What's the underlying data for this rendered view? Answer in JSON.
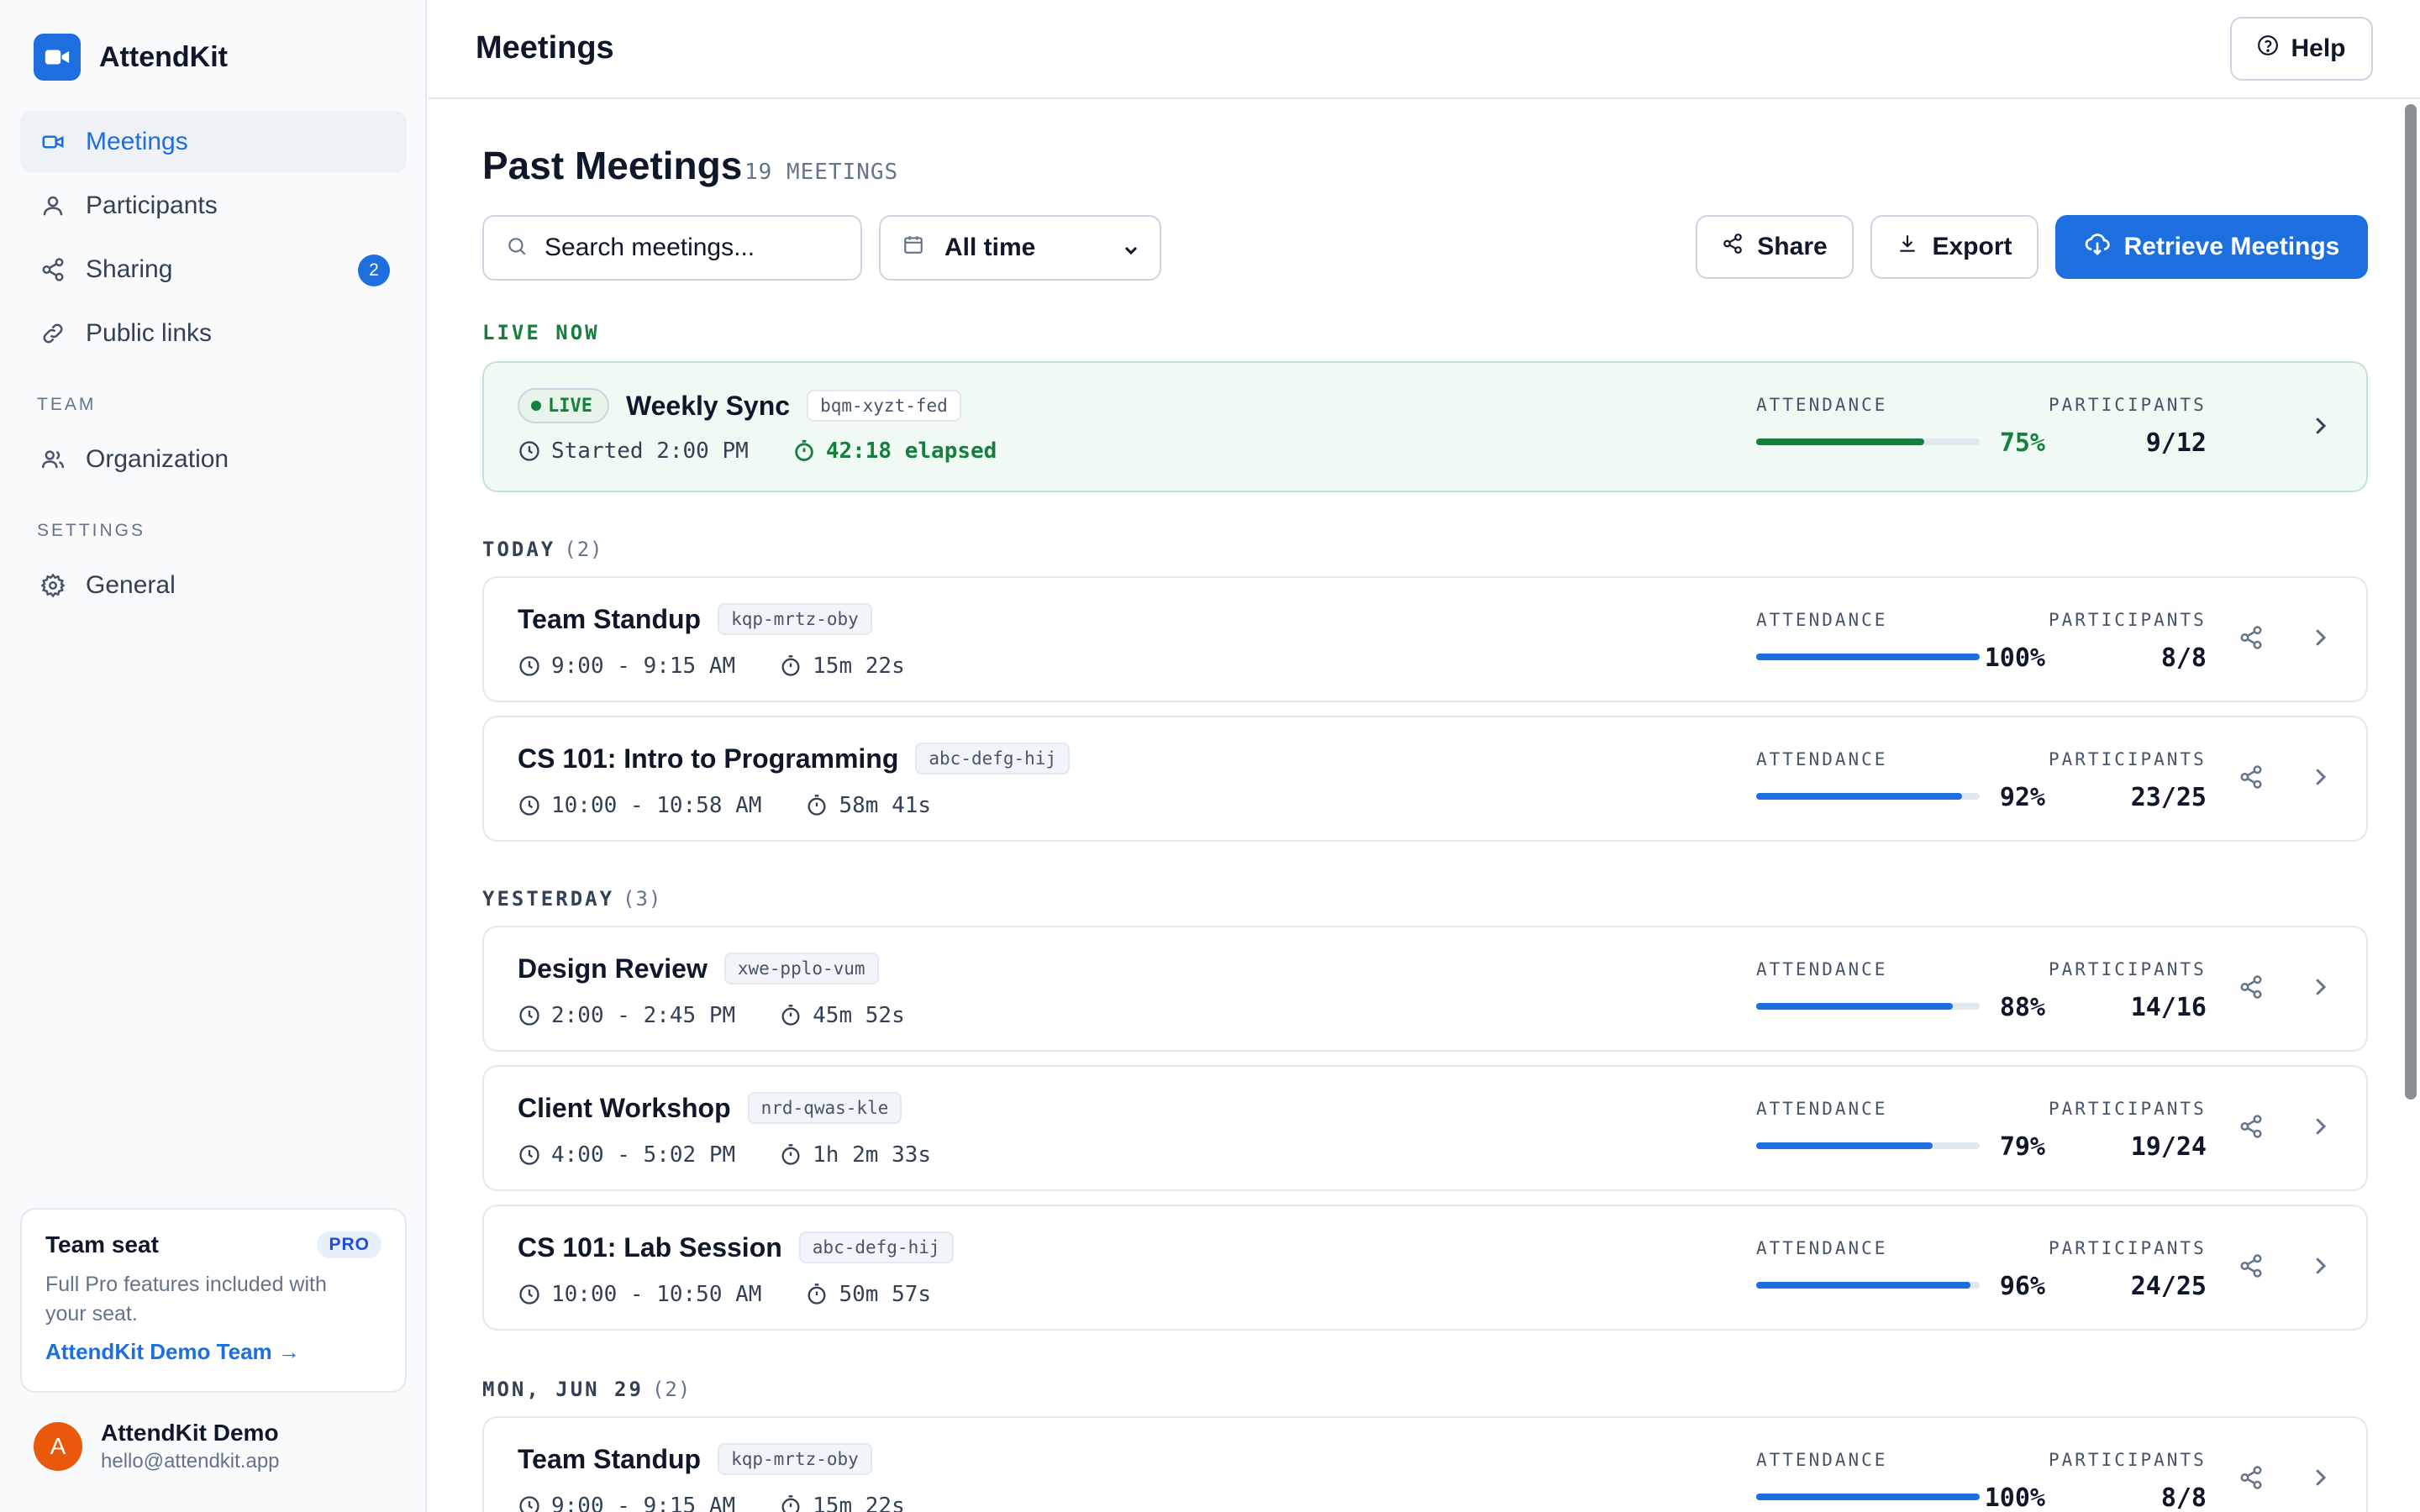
{
  "brand": {
    "name": "AttendKit"
  },
  "sidebar": {
    "items": [
      {
        "label": "Meetings",
        "icon": "video-icon",
        "active": true
      },
      {
        "label": "Participants",
        "icon": "user-icon"
      },
      {
        "label": "Sharing",
        "icon": "share-icon",
        "badge": "2"
      },
      {
        "label": "Public links",
        "icon": "link-icon"
      }
    ],
    "team_section": "TEAM",
    "team_items": [
      {
        "label": "Organization",
        "icon": "users-icon"
      }
    ],
    "settings_section": "SETTINGS",
    "settings_items": [
      {
        "label": "General",
        "icon": "gear-icon"
      }
    ],
    "seat": {
      "title": "Team seat",
      "badge": "PRO",
      "description": "Full Pro features included with your seat.",
      "link": "AttendKit Demo Team →"
    },
    "user": {
      "initial": "A",
      "name": "AttendKit Demo",
      "email": "hello@attendkit.app"
    }
  },
  "topbar": {
    "title": "Meetings",
    "help_label": "Help"
  },
  "main": {
    "title": "Past Meetings",
    "count": "19 MEETINGS",
    "search_placeholder": "Search meetings...",
    "date_filter": "All time",
    "share_label": "Share",
    "export_label": "Export",
    "retrieve_label": "Retrieve Meetings",
    "attendance_label": "ATTENDANCE",
    "participants_label": "PARTICIPANTS"
  },
  "live": {
    "section": "LIVE NOW",
    "badge": "LIVE",
    "title": "Weekly Sync",
    "code": "bqm-xyzt-fed",
    "started": "Started 2:00 PM",
    "elapsed": "42:18 elapsed",
    "attendance_pct": "75%",
    "attendance_value": 0.75,
    "participants": "9/12"
  },
  "sections": [
    {
      "label": "TODAY",
      "count": "(2)",
      "meetings": [
        {
          "title": "Team Standup",
          "code": "kqp-mrtz-oby",
          "time": "9:00 - 9:15 AM",
          "duration": "15m 22s",
          "attendance_pct": "100%",
          "attendance_value": 1.0,
          "participants": "8/8"
        },
        {
          "title": "CS 101: Intro to Programming",
          "code": "abc-defg-hij",
          "time": "10:00 - 10:58 AM",
          "duration": "58m 41s",
          "attendance_pct": "92%",
          "attendance_value": 0.92,
          "participants": "23/25"
        }
      ]
    },
    {
      "label": "YESTERDAY",
      "count": "(3)",
      "meetings": [
        {
          "title": "Design Review",
          "code": "xwe-pplo-vum",
          "time": "2:00 - 2:45 PM",
          "duration": "45m 52s",
          "attendance_pct": "88%",
          "attendance_value": 0.88,
          "participants": "14/16"
        },
        {
          "title": "Client Workshop",
          "code": "nrd-qwas-kle",
          "time": "4:00 - 5:02 PM",
          "duration": "1h 2m 33s",
          "attendance_pct": "79%",
          "attendance_value": 0.79,
          "participants": "19/24"
        },
        {
          "title": "CS 101: Lab Session",
          "code": "abc-defg-hij",
          "time": "10:00 - 10:50 AM",
          "duration": "50m 57s",
          "attendance_pct": "96%",
          "attendance_value": 0.96,
          "participants": "24/25"
        }
      ]
    },
    {
      "label": "MON, JUN 29",
      "count": "(2)",
      "meetings": [
        {
          "title": "Team Standup",
          "code": "kqp-mrtz-oby",
          "time": "9:00 - 9:15 AM",
          "duration": "15m 22s",
          "attendance_pct": "100%",
          "attendance_value": 1.0,
          "participants": "8/8"
        }
      ]
    }
  ],
  "colors": {
    "accent": "#1d6fe0",
    "live": "#15803d",
    "avatar": "#ea580c"
  }
}
